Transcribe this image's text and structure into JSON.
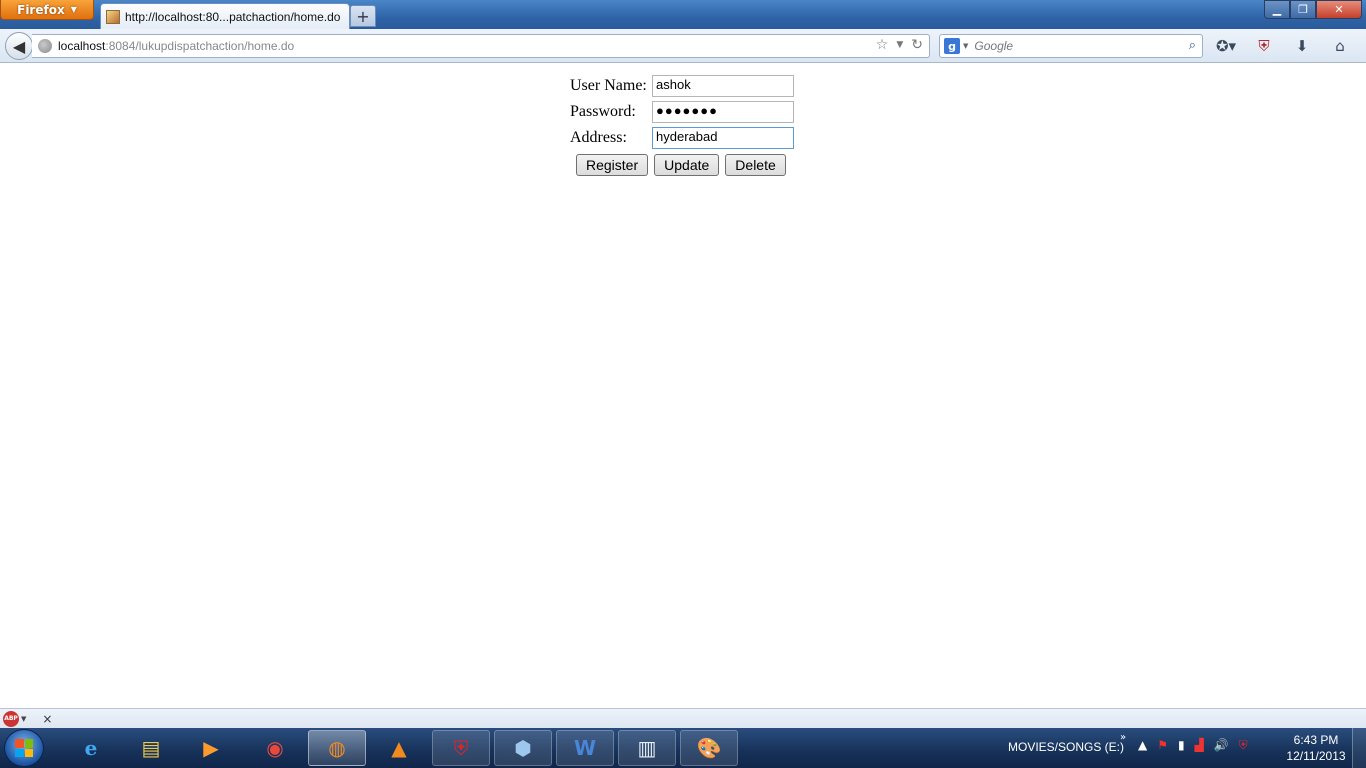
{
  "browser": {
    "menu_label": "Firefox",
    "tab_title": "http://localhost:80...patchaction/home.do",
    "new_tab": "+",
    "url_host": "localhost",
    "url_rest": ":8084/lukupdispatchaction/home.do",
    "search_engine": "g",
    "search_placeholder": "Google"
  },
  "form": {
    "username_label": "User Name:",
    "username_value": "ashok",
    "password_label": "Password:",
    "password_value": "●●●●●●●",
    "address_label": "Address:",
    "address_value": "hyderabad",
    "buttons": {
      "register": "Register",
      "update": "Update",
      "delete": "Delete"
    }
  },
  "addon_bar": {
    "abp_label": "ABP",
    "close": "×"
  },
  "taskbar": {
    "tray_label": "MOVIES/SONGS (E:)",
    "time": "6:43 PM",
    "date": "12/11/2013"
  },
  "colors": {
    "accent": "#2f64a8",
    "firefox_orange": "#e0700f"
  }
}
